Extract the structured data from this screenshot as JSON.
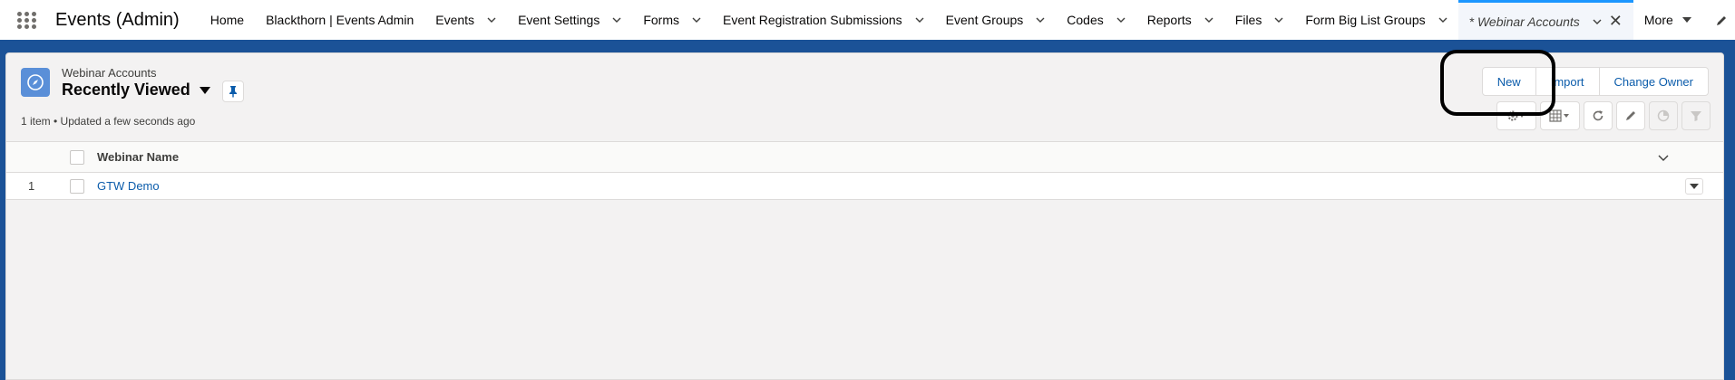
{
  "app": {
    "name": "Events (Admin)"
  },
  "nav": {
    "items": [
      {
        "label": "Home",
        "chevron": false
      },
      {
        "label": "Blackthorn | Events Admin",
        "chevron": false
      },
      {
        "label": "Events",
        "chevron": true
      },
      {
        "label": "Event Settings",
        "chevron": true
      },
      {
        "label": "Forms",
        "chevron": true
      },
      {
        "label": "Event Registration Submissions",
        "chevron": true
      },
      {
        "label": "Event Groups",
        "chevron": true
      },
      {
        "label": "Codes",
        "chevron": true
      },
      {
        "label": "Reports",
        "chevron": true
      },
      {
        "label": "Files",
        "chevron": true
      },
      {
        "label": "Form Big List Groups",
        "chevron": true
      }
    ],
    "active_tab": {
      "label": "* Webinar Accounts",
      "close": "✕"
    },
    "more_label": "More"
  },
  "list_header": {
    "object_label": "Webinar Accounts",
    "view_name": "Recently Viewed",
    "meta": "1 item • Updated a few seconds ago",
    "buttons": {
      "new": "New",
      "import": "Import",
      "change_owner": "Change Owner"
    }
  },
  "table": {
    "columns": [
      "Webinar Name"
    ],
    "rows": [
      {
        "num": "1",
        "name": "GTW Demo"
      }
    ]
  },
  "colors": {
    "brand": "#1b5297",
    "link": "#0b5cab",
    "active_tab_accent": "#1b96ff"
  },
  "icons": [
    "app-launcher-icon",
    "chevron-down-icon",
    "close-icon",
    "pencil-icon",
    "compass-icon",
    "pin-icon",
    "gear-icon",
    "table-icon",
    "refresh-icon",
    "chart-icon",
    "filter-icon"
  ]
}
